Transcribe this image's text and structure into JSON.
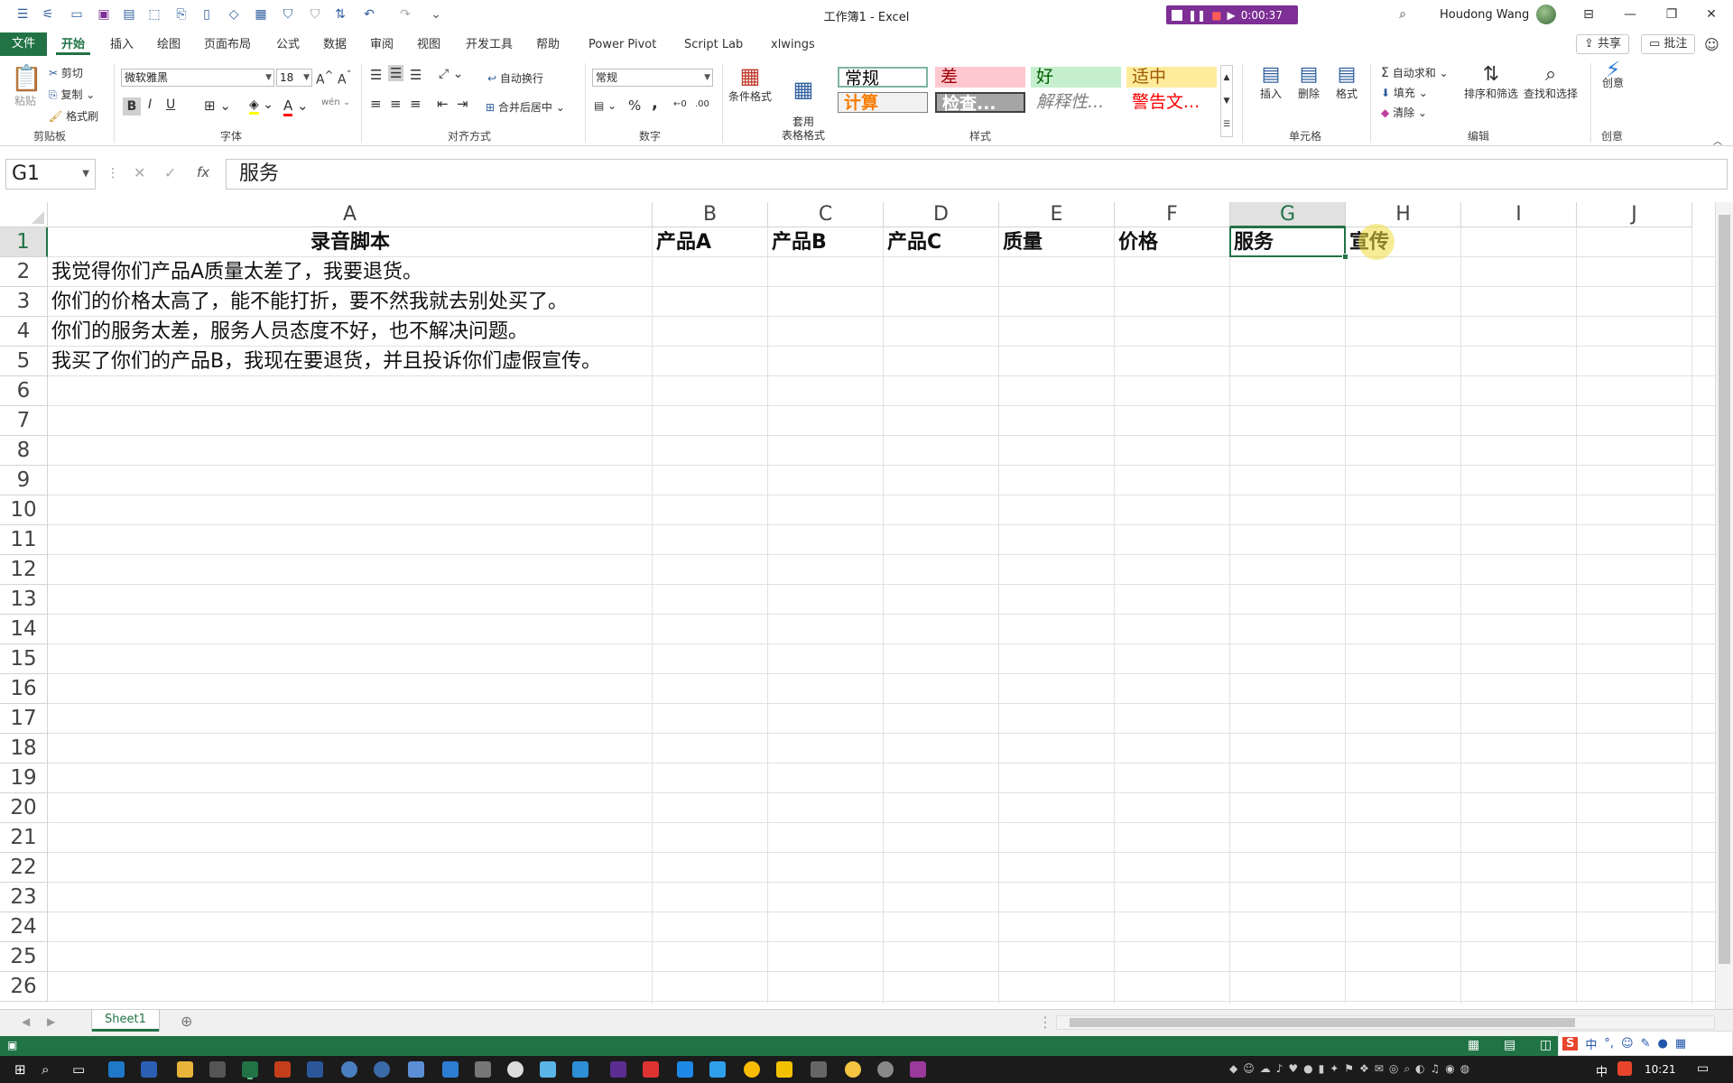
{
  "window": {
    "title": "工作簿1  -  Excel",
    "recording_time": "0:00:37",
    "user_name": "Houdong Wang"
  },
  "menu": {
    "file": "文件",
    "tabs": [
      "开始",
      "插入",
      "绘图",
      "页面布局",
      "公式",
      "数据",
      "审阅",
      "视图",
      "开发工具",
      "帮助",
      "Power Pivot",
      "Script Lab",
      "xlwings"
    ],
    "share": "共享",
    "comments": "批注"
  },
  "ribbon": {
    "clipboard": {
      "label": "剪贴板",
      "paste": "粘贴",
      "cut": "剪切",
      "copy": "复制",
      "format_painter": "格式刷"
    },
    "font": {
      "label": "字体",
      "name": "微软雅黑",
      "size": "18",
      "bold": "B",
      "italic": "I",
      "underline": "U"
    },
    "alignment": {
      "label": "对齐方式",
      "wrap": "自动换行",
      "merge": "合并后居中"
    },
    "number": {
      "label": "数字",
      "format": "常规",
      "percent": "%",
      "comma": ","
    },
    "styles": {
      "label": "样式",
      "conditional": "条件格式",
      "table": "套用\n表格格式",
      "cells": [
        {
          "text": "常规",
          "bg": "#ffffff",
          "color": "#000000"
        },
        {
          "text": "差",
          "bg": "#ffc7ce",
          "color": "#9c0006"
        },
        {
          "text": "好",
          "bg": "#c6efce",
          "color": "#006100"
        },
        {
          "text": "适中",
          "bg": "#ffeb9c",
          "color": "#9c5700"
        },
        {
          "text": "计算",
          "bg": "#f2f2f2",
          "color": "#fa7d00"
        },
        {
          "text": "检查...",
          "bg": "#a5a5a5",
          "color": "#ffffff"
        },
        {
          "text": "解释性...",
          "bg": "#ffffff",
          "color": "#7f7f7f"
        },
        {
          "text": "警告文...",
          "bg": "#ffffff",
          "color": "#ff0000"
        }
      ]
    },
    "cells_group": {
      "label": "单元格",
      "insert": "插入",
      "delete": "删除",
      "format": "格式"
    },
    "editing": {
      "label": "编辑",
      "autosum": "自动求和",
      "fill": "填充",
      "clear": "清除",
      "sort": "排序和筛选",
      "find": "查找和选择"
    },
    "ideas": {
      "label": "创意",
      "button": "创意"
    }
  },
  "formula_bar": {
    "name_box": "G1",
    "content": "服务"
  },
  "sheet": {
    "columns": [
      "A",
      "B",
      "C",
      "D",
      "E",
      "F",
      "G",
      "H",
      "I",
      "J"
    ],
    "rows": [
      "1",
      "2",
      "3",
      "4",
      "5",
      "6",
      "7",
      "8",
      "9",
      "10",
      "11",
      "12",
      "13",
      "14",
      "15",
      "16",
      "17",
      "18",
      "19",
      "20",
      "21",
      "22",
      "23",
      "24",
      "25",
      "26"
    ],
    "header_row": [
      "录音脚本",
      "产品A",
      "产品B",
      "产品C",
      "质量",
      "价格",
      "服务",
      "宣传"
    ],
    "data": [
      "我觉得你们产品A质量太差了，我要退货。",
      "你们的价格太高了，能不能打折，要不然我就去别处买了。",
      "你们的服务太差，服务人员态度不好，也不解决问题。",
      "我买了你们的产品B，我现在要退货，并且投诉你们虚假宣传。"
    ],
    "active_cell": "G1"
  },
  "sheet_tabs": {
    "sheet1": "Sheet1"
  },
  "taskbar": {
    "clock": "10:21",
    "ime": "中"
  },
  "colors": {
    "excel_green": "#217346",
    "record_purple": "#7d2f95"
  }
}
